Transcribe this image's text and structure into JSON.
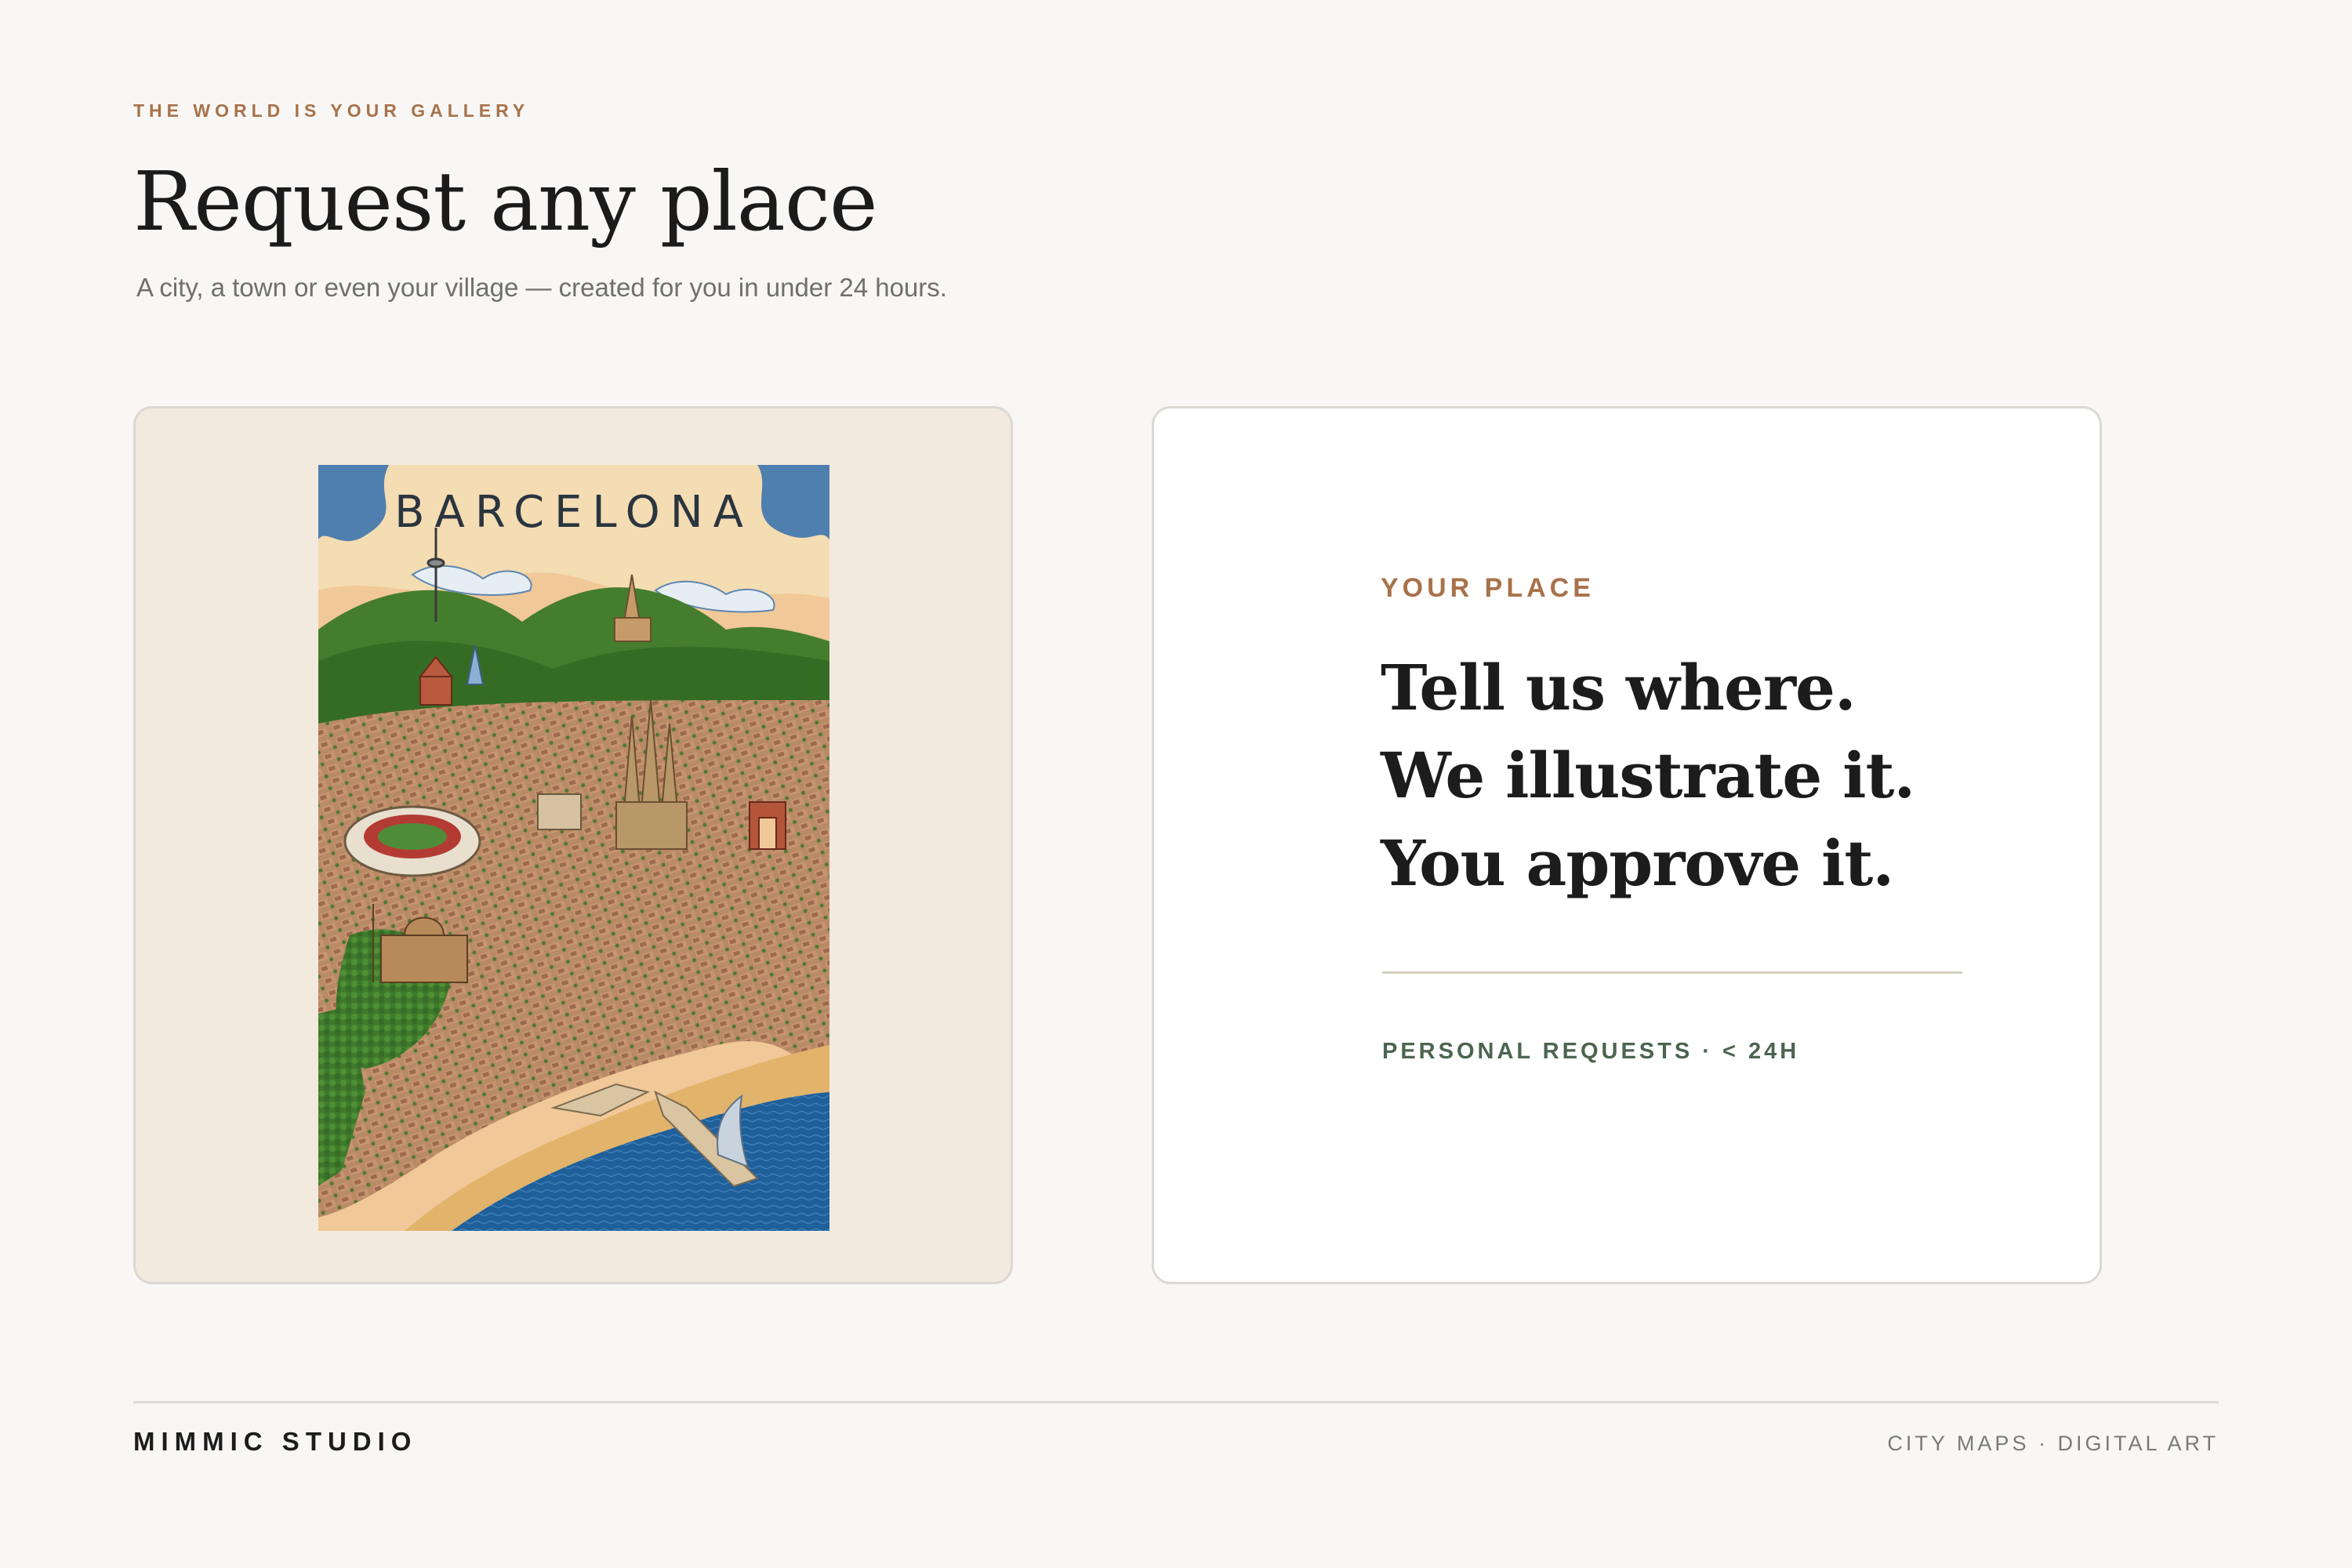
{
  "header": {
    "eyebrow": "THE WORLD IS YOUR GALLERY",
    "title": "Request any place",
    "subtitle": "A city, a town or even your village — created for you in under 24 hours."
  },
  "poster": {
    "title": "BARCELONA"
  },
  "info_card": {
    "eyebrow": "YOUR PLACE",
    "headline_lines": [
      "Tell us where.",
      "We illustrate it.",
      "You approve it."
    ],
    "footnote": "PERSONAL REQUESTS · < 24H"
  },
  "footer": {
    "brand": "MIMMIC STUDIO",
    "tagline": "CITY MAPS · DIGITAL ART"
  },
  "colors": {
    "accent": "#a8724a",
    "green": "#4c6450",
    "background": "#f8f7f5",
    "text": "#1b1b1b"
  }
}
